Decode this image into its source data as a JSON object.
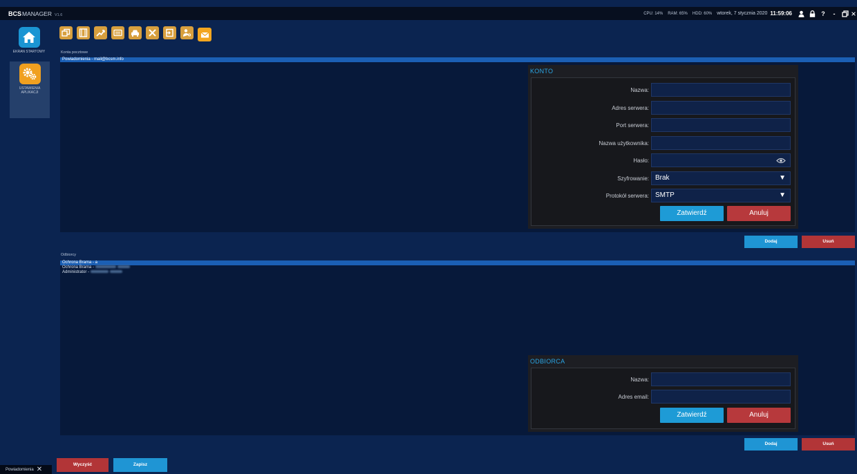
{
  "app": {
    "brand_bold": "BCS",
    "brand_rest": "MANAGER",
    "version": "V1.6"
  },
  "system": {
    "cpu": "CPU: 14%",
    "ram": "RAM: 65%",
    "hdd": "HDD: 60%",
    "date": "wtorek, 7 stycznia 2020",
    "time": "11:59:06",
    "icons": [
      "user-icon",
      "lock-icon",
      "help-icon",
      "minimize-icon",
      "restore-icon",
      "close-icon"
    ],
    "help_glyph": "?",
    "minimize_glyph": "-"
  },
  "nav": {
    "home_label": "EKRAN STARTOWY",
    "settings_label": "USTAWIENIA APLIKACJI"
  },
  "toolbar": {
    "items": [
      "windows-icon",
      "film-icon",
      "chart-icon",
      "keyboard-icon",
      "car-icon",
      "tools-icon",
      "login-icon",
      "user-key-icon",
      "mail-icon"
    ],
    "active": "mail-icon"
  },
  "accounts": {
    "section_label": "Konta pocztowe",
    "rows": [
      {
        "text": "Powiadomienia - mail@bcsm.info",
        "selected": true
      }
    ],
    "add_label": "Dodaj",
    "remove_label": "Usuń"
  },
  "account_form": {
    "title": "KONTO",
    "name_label": "Nazwa:",
    "server_label": "Adres serwera:",
    "port_label": "Port serwera:",
    "user_label": "Nazwa użytkownika:",
    "password_label": "Hasło:",
    "encryption_label": "Szyfrowanie:",
    "encryption_value": "Brak",
    "protocol_label": "Protokół serwera:",
    "protocol_value": "SMTP",
    "confirm_label": "Zatwierdź",
    "cancel_label": "Anuluj",
    "values": {
      "name": "",
      "server": "",
      "port": "",
      "user": "",
      "password": ""
    }
  },
  "recipients": {
    "section_label": "Odbiorcy",
    "rows": [
      {
        "text": "Ochrona Brama - a",
        "selected": true
      },
      {
        "text": "Ochrona Brama - ",
        "selected": false,
        "blurred": true
      },
      {
        "text": "Administrator - ",
        "selected": false,
        "blurred": true
      }
    ],
    "add_label": "Dodaj",
    "remove_label": "Usuń"
  },
  "recipient_form": {
    "title": "ODBIORCA",
    "name_label": "Nazwa:",
    "email_label": "Adres email:",
    "confirm_label": "Zatwierdź",
    "cancel_label": "Anuluj",
    "values": {
      "name": "",
      "email": ""
    }
  },
  "footer": {
    "clear_label": "Wyczyść",
    "save_label": "Zapisz",
    "notification_tab": "Powiadomienia"
  },
  "colors": {
    "accent_blue": "#1e9bd6",
    "cancel_red": "#b7393c",
    "orange": "#f0a020",
    "selection": "#1b5fb4"
  }
}
